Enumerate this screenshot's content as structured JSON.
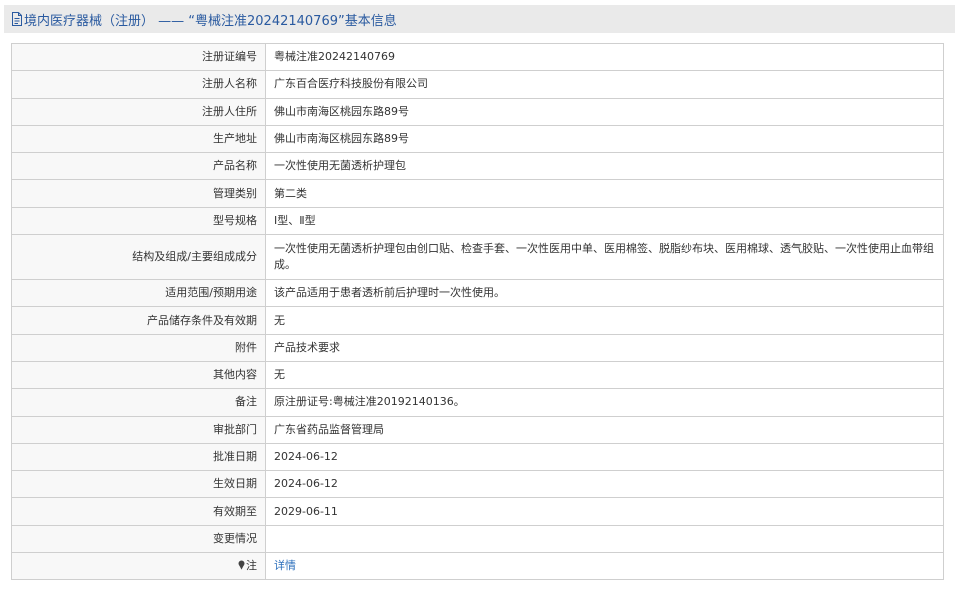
{
  "header": {
    "prefix": "境内医疗器械（注册）",
    "dash": " —— ",
    "quoted": "“粤械注准20242140769”",
    "suffix": "基本信息",
    "icon": "document-icon"
  },
  "rows": [
    {
      "label": "注册证编号",
      "value": "粤械注准20242140769"
    },
    {
      "label": "注册人名称",
      "value": "广东百合医疗科技股份有限公司"
    },
    {
      "label": "注册人住所",
      "value": "佛山市南海区桃园东路89号"
    },
    {
      "label": "生产地址",
      "value": "佛山市南海区桃园东路89号"
    },
    {
      "label": "产品名称",
      "value": "一次性使用无菌透析护理包"
    },
    {
      "label": "管理类别",
      "value": "第二类"
    },
    {
      "label": "型号规格",
      "value": "Ⅰ型、Ⅱ型"
    },
    {
      "label": "结构及组成/主要组成成分",
      "value": "一次性使用无菌透析护理包由创口贴、检查手套、一次性医用中单、医用棉签、脱脂纱布块、医用棉球、透气胶贴、一次性使用止血带组成。"
    },
    {
      "label": "适用范围/预期用途",
      "value": "该产品适用于患者透析前后护理时一次性使用。"
    },
    {
      "label": "产品储存条件及有效期",
      "value": "无"
    },
    {
      "label": "附件",
      "value": "产品技术要求"
    },
    {
      "label": "其他内容",
      "value": "无"
    },
    {
      "label": "备注",
      "value": "原注册证号:粤械注准20192140136。"
    },
    {
      "label": "审批部门",
      "value": "广东省药品监督管理局"
    },
    {
      "label": "批准日期",
      "value": "2024-06-12"
    },
    {
      "label": "生效日期",
      "value": "2024-06-12"
    },
    {
      "label": "有效期至",
      "value": "2029-06-11"
    },
    {
      "label": "变更情况",
      "value": ""
    }
  ],
  "note_row": {
    "label": "注",
    "link": "详情",
    "icon": "pin-icon"
  },
  "colors": {
    "header_bg": "#eaeaea",
    "title": "#2a5aa0",
    "link": "#2a6ebb",
    "label_bg": "#f8f8f8",
    "border": "#cfcfcf"
  }
}
